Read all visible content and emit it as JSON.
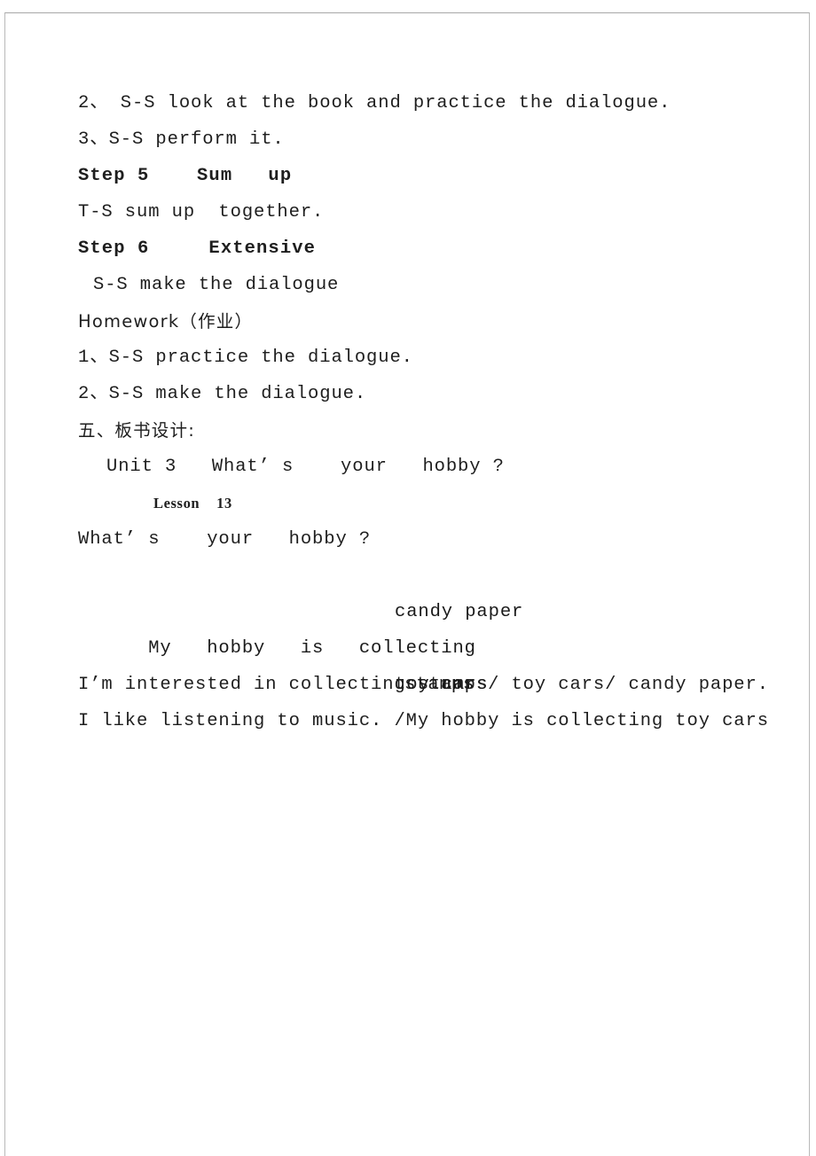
{
  "document": {
    "lines": [
      {
        "id": "l1",
        "text": "2、 S-S look at the book and practice the dialogue."
      },
      {
        "id": "l2",
        "text": "3、S-S perform it."
      },
      {
        "id": "l3",
        "text": "Step 5    Sum   up"
      },
      {
        "id": "l4",
        "text": "T-S sum up  together."
      },
      {
        "id": "l5",
        "text": "Step 6     Extensive"
      },
      {
        "id": "l6",
        "text": "S-S make the dialogue"
      },
      {
        "id": "l7",
        "text": "Homework（作业）"
      },
      {
        "id": "l8",
        "text": "1、S-S practice the dialogue."
      },
      {
        "id": "l9",
        "text": "2、S-S make the dialogue."
      },
      {
        "id": "l10",
        "text": "五、板书设计:"
      },
      {
        "id": "l11",
        "text": "Unit 3   What’ s    your   hobby ?"
      },
      {
        "id": "l12",
        "text": "Lesson    13"
      },
      {
        "id": "l13",
        "text": "What’ s    your   hobby ?"
      },
      {
        "id": "l14",
        "text": "I’m interested in collecting stamps/ toy cars/ candy paper."
      },
      {
        "id": "l15",
        "text": "I like listening to music. /My hobby is collecting toy cars"
      }
    ],
    "board_design": {
      "stem": "My   hobby   is   collecting",
      "options": [
        "candy paper",
        "toy cars",
        "stamps"
      ]
    },
    "colors": {
      "text": "#1e1e1e",
      "page_border": "#b9b9b9",
      "page_background": "#ffffff"
    }
  }
}
